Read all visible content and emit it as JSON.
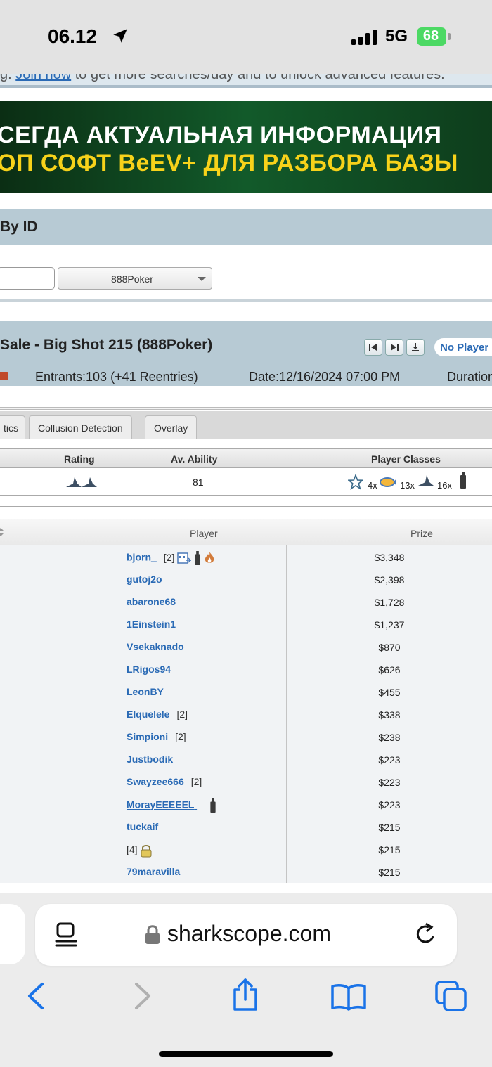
{
  "status_bar": {
    "time": "06.12",
    "network": "5G",
    "battery": "68"
  },
  "notice": {
    "prefix": "g.",
    "link": "Join now",
    "rest": "to get more searches/day and to unlock advanced features."
  },
  "banner": {
    "line1": "СЕГДА АКТУАЛЬНАЯ ИНФОРМАЦИЯ",
    "line2": "ОП СОФТ BeEV+ ДЛЯ РАЗБОРА БАЗЫ"
  },
  "search_by_id": {
    "title": "By ID",
    "network_selected": "888Poker"
  },
  "tournament": {
    "title": "Sale - Big Shot 215 (888Poker)",
    "no_player_button": "No Player",
    "entrants": "Entrants:103 (+41 Reentries)",
    "date": "Date:12/16/2024 07:00 PM",
    "duration": "Duration"
  },
  "tabs": [
    {
      "label": "tics"
    },
    {
      "label": "Collusion Detection"
    },
    {
      "label": "Overlay"
    }
  ],
  "summary": {
    "headers": {
      "rating": "Rating",
      "ability": "Av. Ability",
      "classes": "Player Classes"
    },
    "ability_value": "81",
    "class_counts": {
      "star": "4x",
      "fish": "13x",
      "shark": "16x"
    }
  },
  "results": {
    "headers": {
      "player": "Player",
      "prize": "Prize"
    },
    "rows": [
      {
        "player": "bjorn_",
        "count": "[2]",
        "prize": "$3,348"
      },
      {
        "player": "gutoj2o",
        "count": "",
        "prize": "$2,398"
      },
      {
        "player": "abarone68",
        "count": "",
        "prize": "$1,728"
      },
      {
        "player": "1Einstein1",
        "count": "",
        "prize": "$1,237"
      },
      {
        "player": "Vsekaknado",
        "count": "",
        "prize": "$870"
      },
      {
        "player": "LRigos94",
        "count": "",
        "prize": "$626"
      },
      {
        "player": "LeonBY",
        "count": "",
        "prize": "$455"
      },
      {
        "player": "Elquelele",
        "count": "[2]",
        "prize": "$338"
      },
      {
        "player": "Simpioni",
        "count": "[2]",
        "prize": "$238"
      },
      {
        "player": "Justbodik",
        "count": "",
        "prize": "$223"
      },
      {
        "player": "Swayzee666",
        "count": "[2]",
        "prize": "$223"
      },
      {
        "player": "MorayEEEEEL",
        "count": "",
        "prize": "$223"
      },
      {
        "player": "tuckaif",
        "count": "",
        "prize": "$215"
      },
      {
        "player": "",
        "count": "[4]",
        "prize": "$215"
      },
      {
        "player": "79maravilla",
        "count": "",
        "prize": "$215"
      }
    ]
  },
  "browser": {
    "url": "sharkscope.com"
  }
}
